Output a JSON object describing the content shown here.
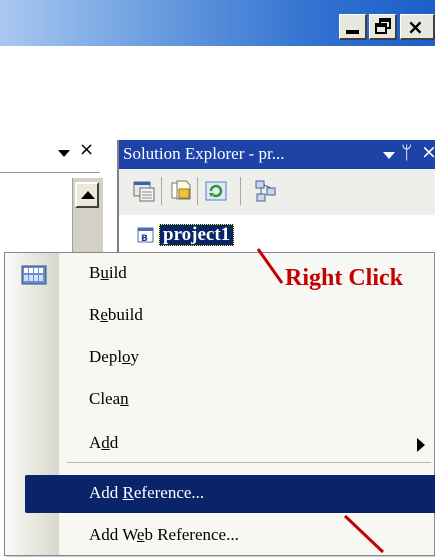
{
  "window": {
    "minimize_icon": "minimize-icon",
    "maximize_icon": "restore-icon",
    "close_icon": "close-icon",
    "close_glyph": "×"
  },
  "left_panel": {
    "dropdown_icon": "chevron-down-icon",
    "close_glyph": "×"
  },
  "solution_explorer": {
    "title": "Solution Explorer - pr...",
    "pin_glyph": "ᛘ",
    "close_glyph": "×",
    "toolbar_icons": [
      "properties-icon",
      "show-all-files-icon",
      "refresh-icon",
      "class-diagram-icon"
    ],
    "project_label": "project1"
  },
  "annotations": {
    "right_click": "Right Click"
  },
  "context_menu": {
    "items": [
      {
        "pre": "B",
        "ul": "u",
        "post": "ild"
      },
      {
        "pre": "R",
        "ul": "e",
        "post": "build"
      },
      {
        "pre": "Depl",
        "ul": "o",
        "post": "y"
      },
      {
        "pre": "Clea",
        "ul": "n",
        "post": ""
      },
      {
        "pre": "A",
        "ul": "d",
        "post": "d"
      },
      {
        "pre": "Add ",
        "ul": "R",
        "post": "eference..."
      },
      {
        "pre": "Add W",
        "ul": "e",
        "post": "b Reference..."
      }
    ],
    "selected_index": 5
  },
  "colors": {
    "selection": "#0a246a",
    "annotation": "#c40000",
    "titlebar": "#1d43a6"
  }
}
